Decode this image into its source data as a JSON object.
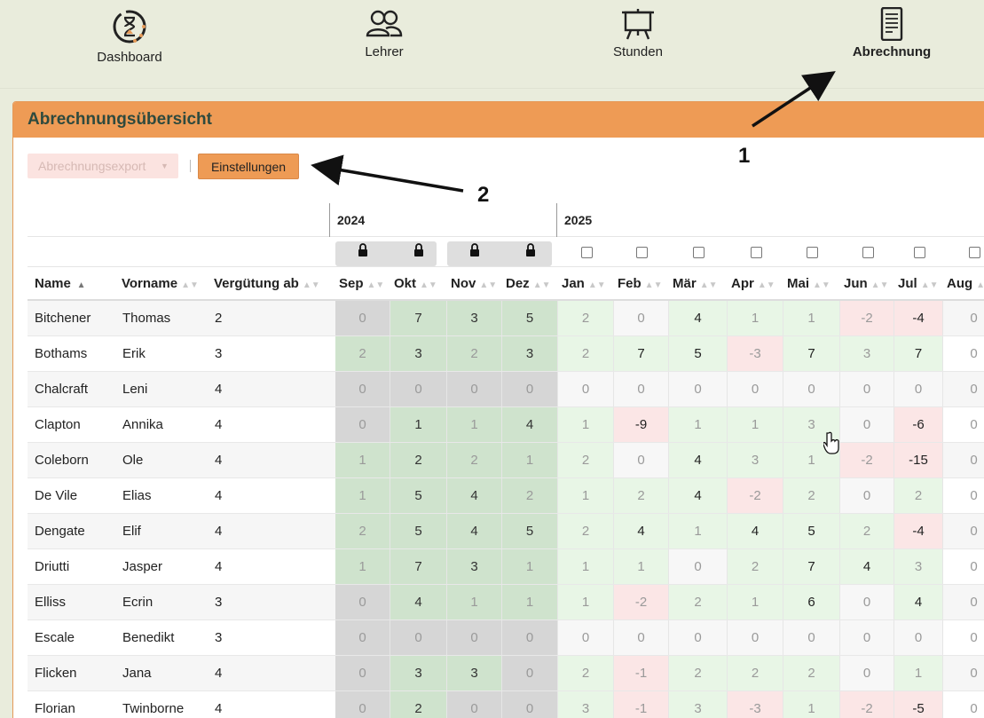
{
  "nav": {
    "items": [
      {
        "label": "Dashboard",
        "icon": "hourglass-clock-icon",
        "active": false
      },
      {
        "label": "Lehrer",
        "icon": "users-icon",
        "active": false
      },
      {
        "label": "Stunden",
        "icon": "presentation-board-icon",
        "active": false
      },
      {
        "label": "Abrechnung",
        "icon": "document-icon",
        "active": true
      }
    ]
  },
  "panel": {
    "title": "Abrechnungsübersicht"
  },
  "toolbar": {
    "export_label": "Abrechnungsexport",
    "settings_label": "Einstellungen"
  },
  "years": [
    "2024",
    "2025"
  ],
  "columns": {
    "name": "Name",
    "vorname": "Vorname",
    "verguetung": "Vergütung ab",
    "months": [
      "Sep",
      "Okt",
      "Nov",
      "Dez",
      "Jan",
      "Feb",
      "Mär",
      "Apr",
      "Mai",
      "Jun",
      "Jul",
      "Aug"
    ]
  },
  "rows": [
    {
      "name": "Bitchener",
      "vorname": "Thomas",
      "verguetung": "2",
      "values": [
        "0",
        "7",
        "3",
        "5",
        "2",
        "0",
        "4",
        "1",
        "1",
        "-2",
        "-4",
        "0"
      ]
    },
    {
      "name": "Bothams",
      "vorname": "Erik",
      "verguetung": "3",
      "values": [
        "2",
        "3",
        "2",
        "3",
        "2",
        "7",
        "5",
        "-3",
        "7",
        "3",
        "7",
        "0"
      ]
    },
    {
      "name": "Chalcraft",
      "vorname": "Leni",
      "verguetung": "4",
      "values": [
        "0",
        "0",
        "0",
        "0",
        "0",
        "0",
        "0",
        "0",
        "0",
        "0",
        "0",
        "0"
      ]
    },
    {
      "name": "Clapton",
      "vorname": "Annika",
      "verguetung": "4",
      "values": [
        "0",
        "1",
        "1",
        "4",
        "1",
        "-9",
        "1",
        "1",
        "3",
        "0",
        "-6",
        "0"
      ]
    },
    {
      "name": "Coleborn",
      "vorname": "Ole",
      "verguetung": "4",
      "values": [
        "1",
        "2",
        "2",
        "1",
        "2",
        "0",
        "4",
        "3",
        "1",
        "-2",
        "-15",
        "0"
      ]
    },
    {
      "name": "De Vile",
      "vorname": "Elias",
      "verguetung": "4",
      "values": [
        "1",
        "5",
        "4",
        "2",
        "1",
        "2",
        "4",
        "-2",
        "2",
        "0",
        "2",
        "0"
      ]
    },
    {
      "name": "Dengate",
      "vorname": "Elif",
      "verguetung": "4",
      "values": [
        "2",
        "5",
        "4",
        "5",
        "2",
        "4",
        "1",
        "4",
        "5",
        "2",
        "-4",
        "0"
      ]
    },
    {
      "name": "Driutti",
      "vorname": "Jasper",
      "verguetung": "4",
      "values": [
        "1",
        "7",
        "3",
        "1",
        "1",
        "1",
        "0",
        "2",
        "7",
        "4",
        "3",
        "0"
      ]
    },
    {
      "name": "Elliss",
      "vorname": "Ecrin",
      "verguetung": "3",
      "values": [
        "0",
        "4",
        "1",
        "1",
        "1",
        "-2",
        "2",
        "1",
        "6",
        "0",
        "4",
        "0"
      ]
    },
    {
      "name": "Escale",
      "vorname": "Benedikt",
      "verguetung": "3",
      "values": [
        "0",
        "0",
        "0",
        "0",
        "0",
        "0",
        "0",
        "0",
        "0",
        "0",
        "0",
        "0"
      ]
    },
    {
      "name": "Flicken",
      "vorname": "Jana",
      "verguetung": "4",
      "values": [
        "0",
        "3",
        "3",
        "0",
        "2",
        "-1",
        "2",
        "2",
        "2",
        "0",
        "1",
        "0"
      ]
    },
    {
      "name": "Florian",
      "vorname": "Twinborne",
      "verguetung": "4",
      "values": [
        "0",
        "2",
        "0",
        "0",
        "3",
        "-1",
        "3",
        "-3",
        "1",
        "-2",
        "-5",
        "0"
      ]
    }
  ],
  "annotations": [
    "1",
    "2"
  ]
}
